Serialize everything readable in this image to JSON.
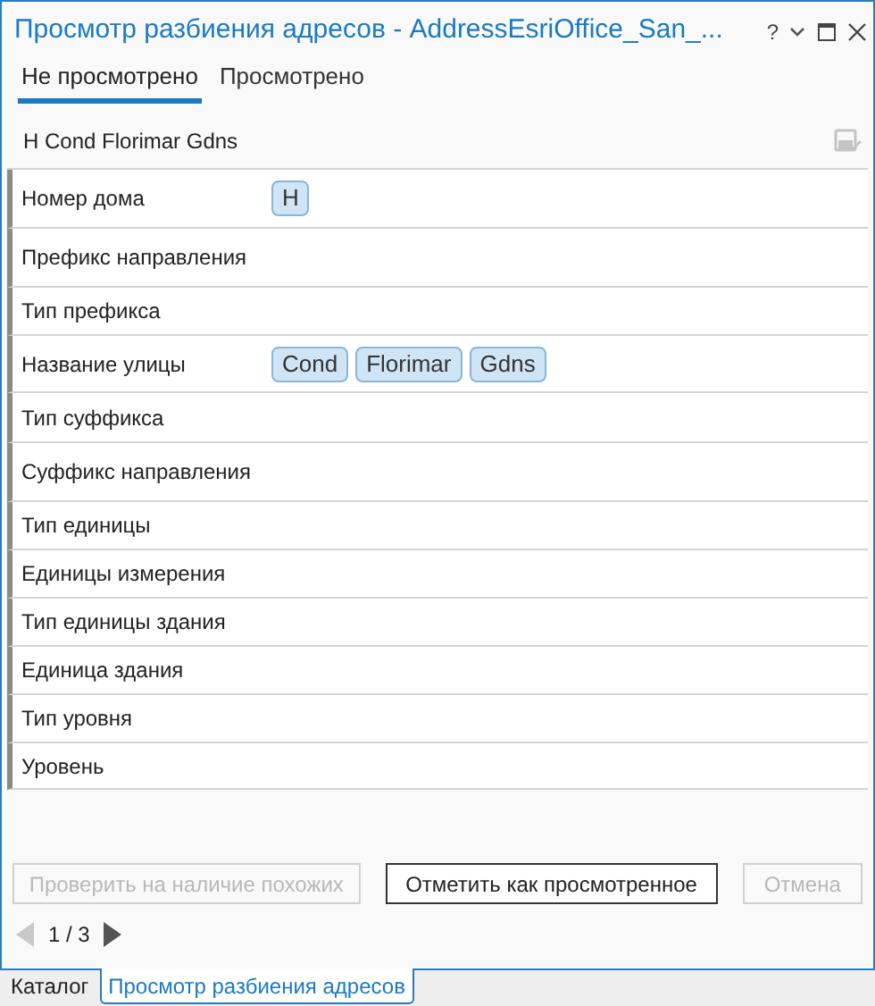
{
  "window": {
    "title": "Просмотр разбиения адресов - AddressEsriOffice_San_...",
    "controls": [
      "?"
    ]
  },
  "tabs": [
    {
      "label": "Не просмотрено",
      "selected": true
    },
    {
      "label": "Просмотрено",
      "selected": false
    }
  ],
  "address": {
    "text": "H Cond Florimar Gdns",
    "save_disabled": true
  },
  "fields": [
    {
      "label": "Номер дома",
      "tokens": [
        "H"
      ]
    },
    {
      "label": "Префикс направления"
    },
    {
      "label": "Тип префикса"
    },
    {
      "label": "Название улицы",
      "tokens": [
        "Cond",
        "Florimar",
        "Gdns"
      ]
    },
    {
      "label": "Тип суффикса"
    },
    {
      "label": "Суффикс направления"
    },
    {
      "label": "Тип единицы"
    },
    {
      "label": "Единицы измерения"
    },
    {
      "label": "Тип единицы здания"
    },
    {
      "label": "Единица здания"
    },
    {
      "label": "Тип уровня"
    },
    {
      "label": "Уровень"
    }
  ],
  "buttons": [
    {
      "label": "Проверить на наличие похожих",
      "disabled": true
    },
    {
      "label": "Отметить как просмотренное",
      "disabled": false
    },
    {
      "label": "Отмена",
      "disabled": true
    }
  ],
  "pager": {
    "text": "1 / 3",
    "prev_disabled": true,
    "next_disabled": false
  },
  "bottom_tabs": [
    {
      "label": "Каталог",
      "selected": false
    },
    {
      "label": "Просмотр разбиения адресов",
      "selected": true
    }
  ]
}
